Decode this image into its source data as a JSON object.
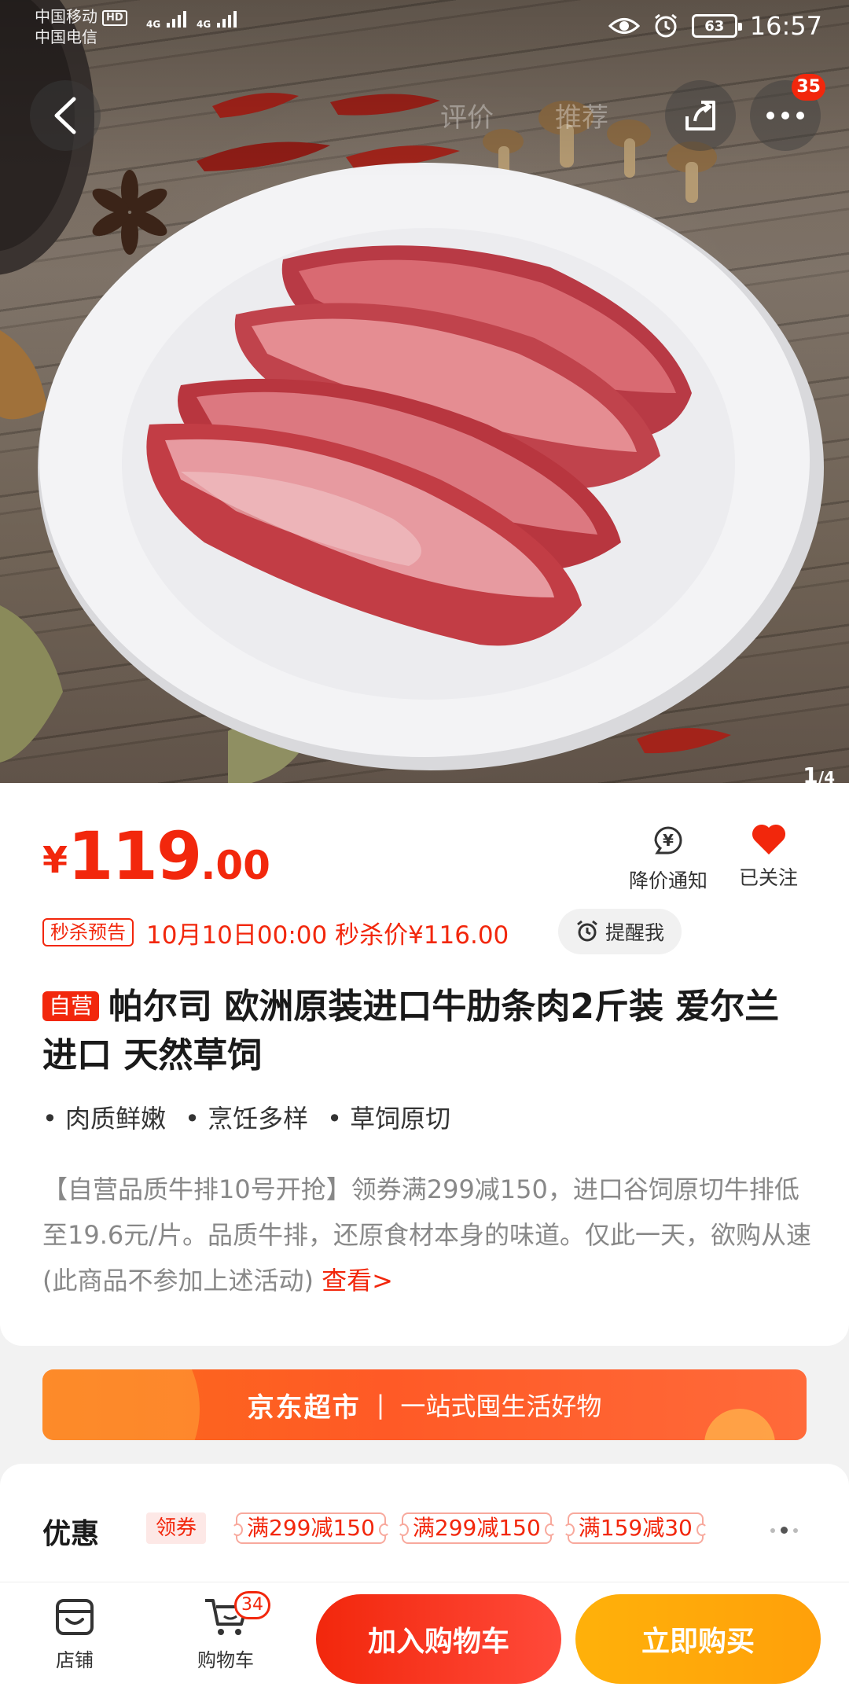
{
  "status_bar": {
    "carrier1": "中国移动",
    "hd": "HD",
    "carrier2": "中国电信",
    "net1": "4G",
    "net2": "4G",
    "battery": "63",
    "time": "16:57"
  },
  "nav": {
    "tabs": [
      "评价",
      "推荐"
    ],
    "more_badge": "35"
  },
  "gallery": {
    "counter_current": "1",
    "counter_total": "/4",
    "icon": "product-photo-beef-plate"
  },
  "product": {
    "price_currency": "¥",
    "price_int": "119",
    "price_dec": ".00",
    "price_alert_label": "降价通知",
    "follow_label": "已关注",
    "flash_tag": "秒杀预告",
    "flash_text": "10月10日00:00 秒杀价¥116.00",
    "remind_label": "提醒我",
    "self_tag": "自营",
    "title": "帕尔司 欧洲原装进口牛肋条肉2斤装 爱尔兰进口 天然草饲",
    "features": [
      "肉质鲜嫩",
      "烹饪多样",
      "草饲原切"
    ],
    "promo_desc": "【自营品质牛排10号开抢】领券满299减150，进口谷饲原切牛排低至19.6元/片。品质牛排，还原食材本身的味道。仅此一天，欲购从速(此商品不参加上述活动) ",
    "promo_more": "查看>"
  },
  "banner": {
    "brand": "京东超市",
    "separator": "|",
    "slogan": "一站式囤生活好物"
  },
  "coupons": {
    "label": "优惠",
    "tag": "领券",
    "items": [
      "满299减150",
      "满299减150",
      "满159减30"
    ]
  },
  "bottom_bar": {
    "shop_label": "店铺",
    "cart_label": "购物车",
    "cart_count": "34",
    "add_to_cart": "加入购物车",
    "buy_now": "立即购买"
  },
  "colors": {
    "accent_red": "#f2270c",
    "buy_orange": "#ffa00a",
    "banner_orange": "#ff5a26"
  }
}
